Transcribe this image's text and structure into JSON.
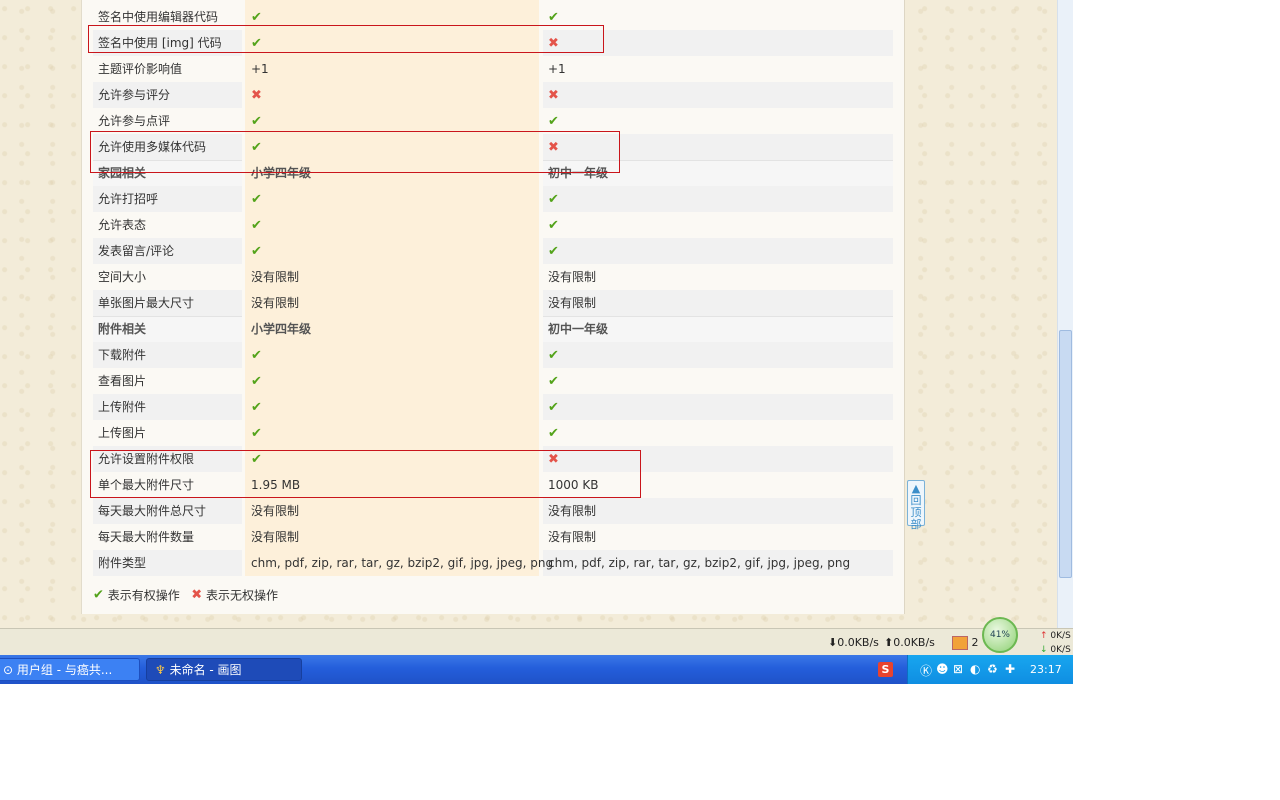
{
  "rows": [
    {
      "label": "签名中使用编辑器代码",
      "v1": "✔",
      "v2": "✔",
      "t1": "yes",
      "t2": "yes",
      "style": "normal"
    },
    {
      "label": "签名中使用 [img] 代码",
      "v1": "✔",
      "v2": "✖",
      "t1": "yes",
      "t2": "no",
      "style": "alt"
    },
    {
      "label": "主题评价影响值",
      "v1": "+1",
      "v2": "+1",
      "t1": "text",
      "t2": "text",
      "style": "normal"
    },
    {
      "label": "允许参与评分",
      "v1": "✖",
      "v2": "✖",
      "t1": "no",
      "t2": "no",
      "style": "alt"
    },
    {
      "label": "允许参与点评",
      "v1": "✔",
      "v2": "✔",
      "t1": "yes",
      "t2": "yes",
      "style": "normal"
    },
    {
      "label": "允许使用多媒体代码",
      "v1": "✔",
      "v2": "✖",
      "t1": "yes",
      "t2": "no",
      "style": "alt"
    },
    {
      "label": "家园相关",
      "v1": "小学四年级",
      "v2": "初中一年级",
      "t1": "text",
      "t2": "text",
      "style": "group"
    },
    {
      "label": "允许打招呼",
      "v1": "✔",
      "v2": "✔",
      "t1": "yes",
      "t2": "yes",
      "style": "alt"
    },
    {
      "label": "允许表态",
      "v1": "✔",
      "v2": "✔",
      "t1": "yes",
      "t2": "yes",
      "style": "normal"
    },
    {
      "label": "发表留言/评论",
      "v1": "✔",
      "v2": "✔",
      "t1": "yes",
      "t2": "yes",
      "style": "alt"
    },
    {
      "label": "空间大小",
      "v1": "没有限制",
      "v2": "没有限制",
      "t1": "text",
      "t2": "text",
      "style": "normal"
    },
    {
      "label": "单张图片最大尺寸",
      "v1": "没有限制",
      "v2": "没有限制",
      "t1": "text",
      "t2": "text",
      "style": "alt"
    },
    {
      "label": "附件相关",
      "v1": "小学四年级",
      "v2": "初中一年级",
      "t1": "text",
      "t2": "text",
      "style": "group"
    },
    {
      "label": "下载附件",
      "v1": "✔",
      "v2": "✔",
      "t1": "yes",
      "t2": "yes",
      "style": "alt"
    },
    {
      "label": "查看图片",
      "v1": "✔",
      "v2": "✔",
      "t1": "yes",
      "t2": "yes",
      "style": "normal"
    },
    {
      "label": "上传附件",
      "v1": "✔",
      "v2": "✔",
      "t1": "yes",
      "t2": "yes",
      "style": "alt"
    },
    {
      "label": "上传图片",
      "v1": "✔",
      "v2": "✔",
      "t1": "yes",
      "t2": "yes",
      "style": "normal"
    },
    {
      "label": "允许设置附件权限",
      "v1": "✔",
      "v2": "✖",
      "t1": "yes",
      "t2": "no",
      "style": "alt"
    },
    {
      "label": "单个最大附件尺寸",
      "v1": "1.95 MB",
      "v2": "1000 KB",
      "t1": "text",
      "t2": "text",
      "style": "normal"
    },
    {
      "label": "每天最大附件总尺寸",
      "v1": "没有限制",
      "v2": "没有限制",
      "t1": "text",
      "t2": "text",
      "style": "alt"
    },
    {
      "label": "每天最大附件数量",
      "v1": "没有限制",
      "v2": "没有限制",
      "t1": "text",
      "t2": "text",
      "style": "normal"
    },
    {
      "label": "附件类型",
      "v1": "chm, pdf, zip, rar, tar, gz, bzip2, gif, jpg, jpeg, png",
      "v2": "chm, pdf, zip, rar, tar, gz, bzip2, gif, jpg, jpeg, png",
      "t1": "text",
      "t2": "text",
      "style": "alt"
    }
  ],
  "legend": {
    "yes_icon": "✔",
    "yes_label": "表示有权操作",
    "no_icon": "✖",
    "no_label": "表示无权操作"
  },
  "back_to_top": "回顶部",
  "statusbar": {
    "down_speed": "0.0KB/s",
    "up_speed": "0.0KB/s",
    "notify_count": "2",
    "gauge": "41%",
    "net_up": "0K/S",
    "net_down": "0K/S"
  },
  "taskbar": {
    "task1": "用户组 - 与癌共...",
    "task2": "未命名 - 画图",
    "clock": "23:17",
    "sogou": "S"
  },
  "colors": {
    "yes": "#53a31a",
    "no": "#e4544a",
    "highlight_box": "#c9151b"
  }
}
